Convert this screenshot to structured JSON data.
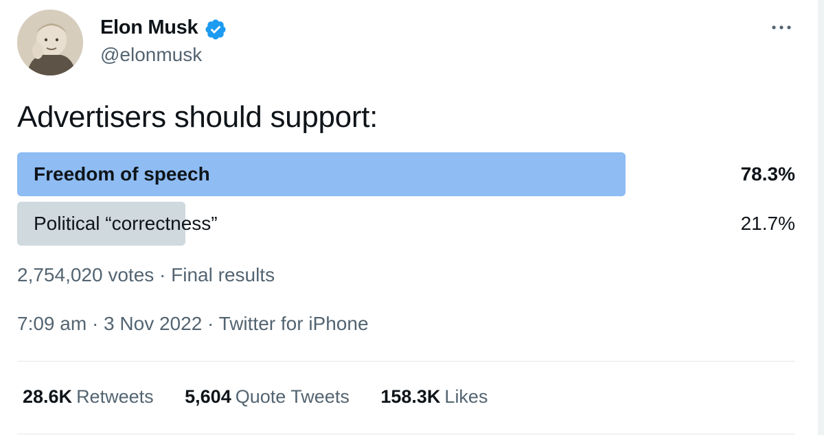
{
  "tweet": {
    "author": {
      "name": "Elon Musk",
      "handle": "@elonmusk",
      "verified": true,
      "avatar_icon": "avatar-photo"
    },
    "text": "Advertisers should support:",
    "poll": {
      "options": [
        {
          "label": "Freedom of speech",
          "percent": "78.3%",
          "fraction": 0.783,
          "winner": true
        },
        {
          "label": "Political “correctness”",
          "percent": "21.7%",
          "fraction": 0.217,
          "winner": false
        }
      ],
      "meta": "2,754,020 votes · Final results"
    },
    "timestamp": "7:09 am · 3 Nov 2022 · Twitter for iPhone",
    "stats": [
      {
        "count": "28.6K",
        "label": "Retweets"
      },
      {
        "count": "5,604",
        "label": "Quote Tweets"
      },
      {
        "count": "158.3K",
        "label": "Likes"
      }
    ]
  },
  "colors": {
    "accent": "#1d9bf0",
    "winner_bar": "#8ebcf3",
    "loser_bar": "#cfd9de",
    "secondary_text": "#536471",
    "primary_text": "#0f1419"
  },
  "icons": {
    "verified": "verified-badge-icon",
    "more": "more-options-icon"
  }
}
